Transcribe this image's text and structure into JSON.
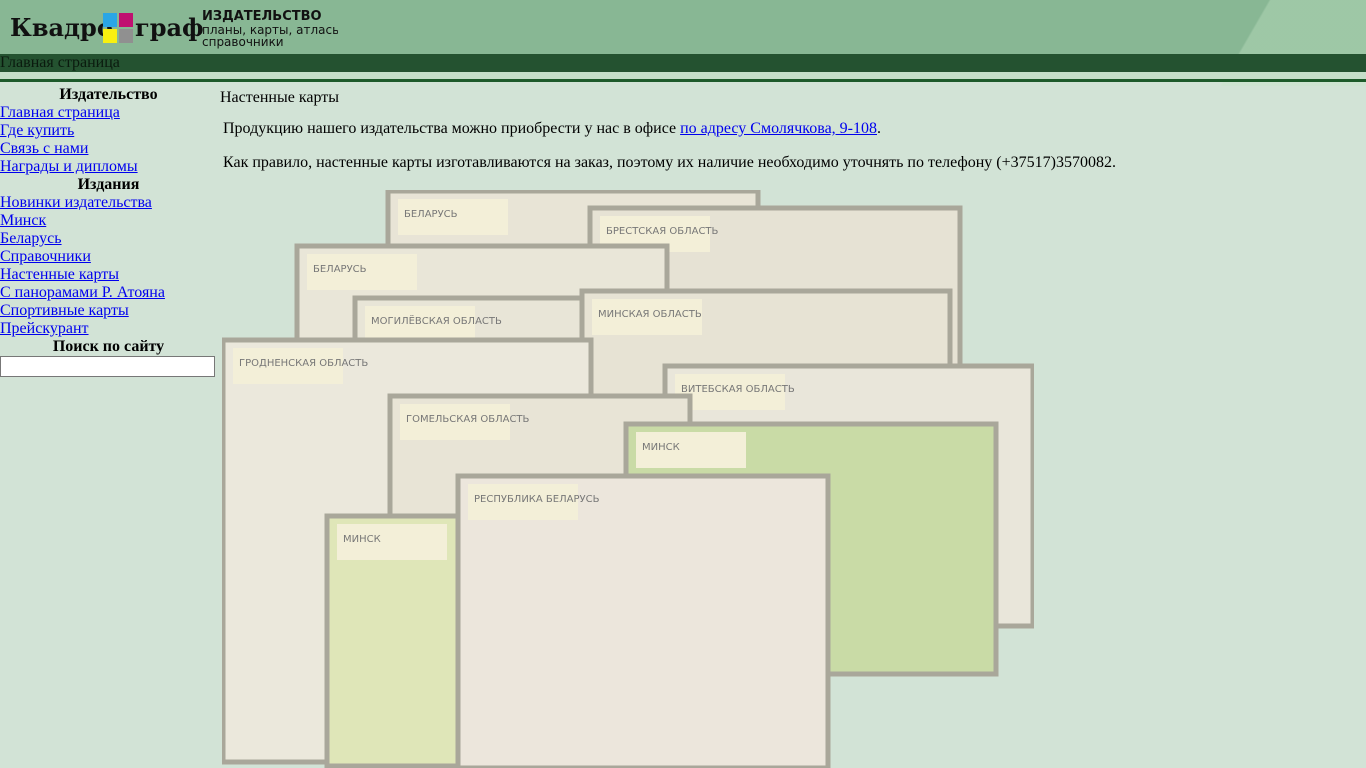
{
  "header": {
    "logo_text": "Квадрограф",
    "logo_tagline_1": "ИЗДАТЕЛЬСТВО",
    "logo_tagline_2": "планы, карты, атласы",
    "logo_tagline_3": "справочники",
    "breadcrumb": "Главная страница"
  },
  "sidebar": {
    "section1": "Издательство",
    "links1": [
      "Главная страница",
      "Где купить",
      "Связь с нами",
      "Награды и дипломы"
    ],
    "section2": "Издания",
    "links2": [
      "Новинки издательства",
      "Минск",
      "Беларусь",
      "Справочники",
      "Настенные карты",
      "С панорамами Р. Атояна",
      "Спортивные карты",
      "Прейскурант"
    ],
    "section3": "Поиск по сайту",
    "search_value": ""
  },
  "main": {
    "title": "Настенные карты",
    "p1_before": "Продукцию нашего издательства можно приобрести у нас в офисе ",
    "p1_link": "по адресу Смолячкова, 9-108",
    "p1_after": ".",
    "p2": "Как правило, настенные карты изготавливаются на заказ, поэтому их наличие необходимо уточнять по телефону (+37517)3570082.",
    "maps": [
      "БЕЛАРУСЬ",
      "БРЕСТСКАЯ ОБЛАСТЬ",
      "БЕЛАРУСЬ",
      "МОГИЛЁВСКАЯ ОБЛАСТЬ",
      "МИНСКАЯ ОБЛАСТЬ",
      "ГРОДНЕНСКАЯ ОБЛАСТЬ",
      "ВИТЕБСКАЯ ОБЛАСТЬ",
      "ГОМЕЛЬСКАЯ ОБЛАСТЬ",
      "МИНСК",
      "МИНСК",
      "РЕСПУБЛИКА БЕЛАРУСЬ"
    ]
  }
}
